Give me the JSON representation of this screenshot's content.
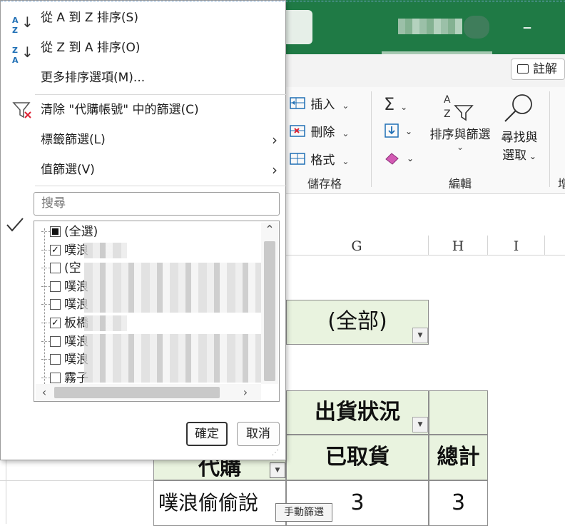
{
  "ribbon": {
    "comment_label": "註解",
    "cells_group": {
      "insert": "插入",
      "delete": "刪除",
      "format": "格式",
      "label": "儲存格"
    },
    "editing_group": {
      "sort_filter": "排序與篩選",
      "find_select_1": "尋找與",
      "find_select_2": "選取",
      "label": "編輯"
    },
    "partial_next_group": "增"
  },
  "columns": [
    "G",
    "H",
    "I"
  ],
  "sheet": {
    "filter_value": "(全部)",
    "pivot_col_header": "出貨狀況",
    "row_header_partial": "代購",
    "subheader_taken": "已取貨",
    "subheader_total": "總計",
    "row1_name": "噗浪偷偷說",
    "row1_taken": "3",
    "row1_total": "3"
  },
  "menu": {
    "sort_az": "從 A 到 Z 排序(S)",
    "sort_za": "從 Z 到 A 排序(O)",
    "more_sort": "更多排序選項(M)...",
    "clear_filter": "清除 \"代購帳號\" 中的篩選(C)",
    "label_filter": "標籤篩選(L)",
    "value_filter": "值篩選(V)",
    "search_placeholder": "搜尋",
    "ok": "確定",
    "cancel": "取消"
  },
  "list": [
    {
      "label": "(全選)",
      "state": "partial"
    },
    {
      "label": "噗浪",
      "state": "checked"
    },
    {
      "label": "(空",
      "state": "unchecked"
    },
    {
      "label": "噗浪",
      "state": "unchecked"
    },
    {
      "label": "噗浪",
      "state": "unchecked"
    },
    {
      "label": "板橋",
      "state": "checked"
    },
    {
      "label": "噗浪",
      "state": "unchecked"
    },
    {
      "label": "噗浪",
      "state": "unchecked"
    },
    {
      "label": "霧子",
      "state": "unchecked"
    }
  ],
  "tooltip": "手動篩選",
  "colors": {
    "titlebar": "#1f7a45",
    "cell_fill": "#e9f3df"
  }
}
